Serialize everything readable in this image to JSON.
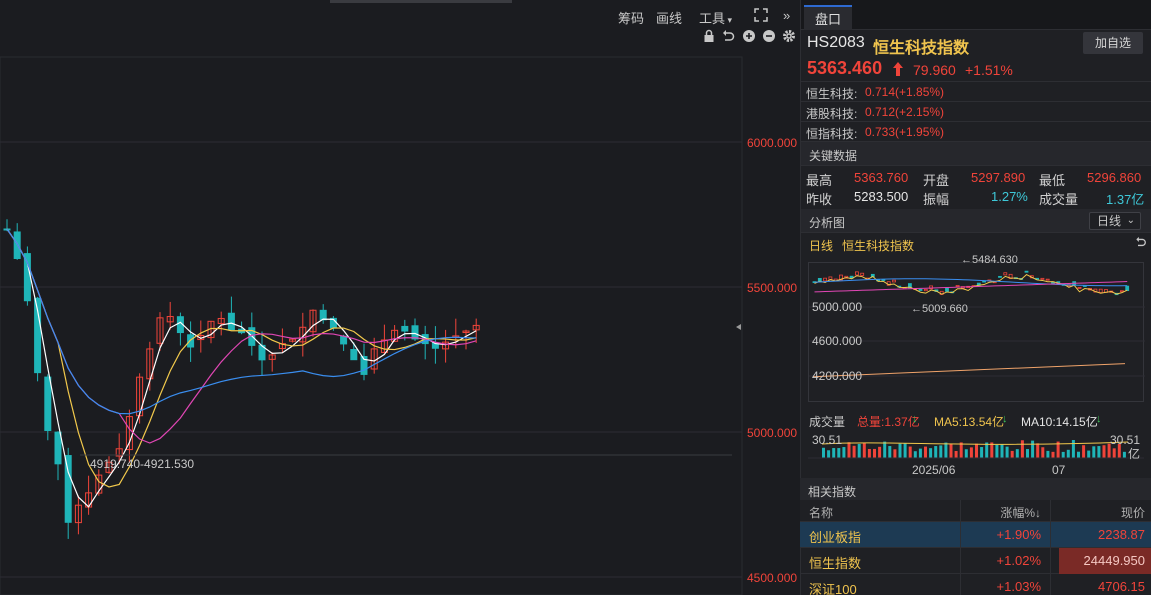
{
  "toolbar": {
    "chips": "筹码",
    "draw": "画线",
    "tools": "工具",
    "expand_icon": "expand-icon",
    "collapse_icon": "double-chevron-right-icon"
  },
  "chart_icons": [
    "lock-icon",
    "undo-icon",
    "zoom-in-icon",
    "zoom-out-icon",
    "gear-icon"
  ],
  "main_chart": {
    "price_ticks": [
      "6000.000",
      "5500.000",
      "5000.000",
      "4500.000"
    ],
    "annotation": "4919.740-4921.530"
  },
  "panel": {
    "tab": "盘口",
    "symbol": {
      "code": "HS2083",
      "name": "恒生科技指数",
      "add_watch": "加自选"
    },
    "quote": {
      "price": "5363.460",
      "change": "79.960",
      "change_pct": "+1.51%"
    },
    "related_etfs": [
      {
        "label": "恒生科技:",
        "value": "0.714(+1.85%)"
      },
      {
        "label": "港股科技:",
        "value": "0.712(+2.15%)"
      },
      {
        "label": "恒指科技:",
        "value": "0.733(+1.95%)"
      }
    ],
    "key_data": {
      "title": "关键数据",
      "high_label": "最高",
      "high": "5363.760",
      "open_label": "开盘",
      "open": "5297.890",
      "low_label": "最低",
      "low": "5296.860",
      "prev_label": "昨收",
      "prev": "5283.500",
      "amp_label": "振幅",
      "amp": "1.27%",
      "vol_label": "成交量",
      "vol": "1.37亿"
    },
    "analysis": {
      "title": "分析图",
      "period": "日线",
      "legend_period": "日线",
      "legend_name": "恒生科技指数",
      "refresh_icon": "undo-icon"
    },
    "mini_chart": {
      "high_label": "5484.630",
      "low_label": "5009.660",
      "y_ticks": [
        "5000.000",
        "4600.000",
        "4200.000"
      ]
    },
    "volume": {
      "title": "成交量",
      "total": "总量:1.37亿",
      "ma5": "MA5:13.54亿",
      "ma10": "MA10:14.15亿",
      "left_val": "30.51",
      "right_val": "30.51",
      "unit": "亿",
      "x_labels": [
        "2025/06",
        "07"
      ]
    },
    "related": {
      "title": "相关指数",
      "headers": {
        "name": "名称",
        "pct": "涨幅%↓",
        "price": "现价"
      },
      "rows": [
        {
          "name": "创业板指",
          "pct": "+1.90%",
          "price": "2238.87"
        },
        {
          "name": "恒生指数",
          "pct": "+1.02%",
          "price": "24449.950"
        },
        {
          "name": "深证100",
          "pct": "+1.03%",
          "price": "4706.15"
        }
      ]
    }
  },
  "colors": {
    "up": "#f0443a",
    "down": "#1fb5b8",
    "ma5": "#ffffff",
    "ma10": "#f2c94c",
    "ma20": "#e046b4",
    "ma60": "#3a8ef0",
    "accent": "#2e6ad1"
  }
}
